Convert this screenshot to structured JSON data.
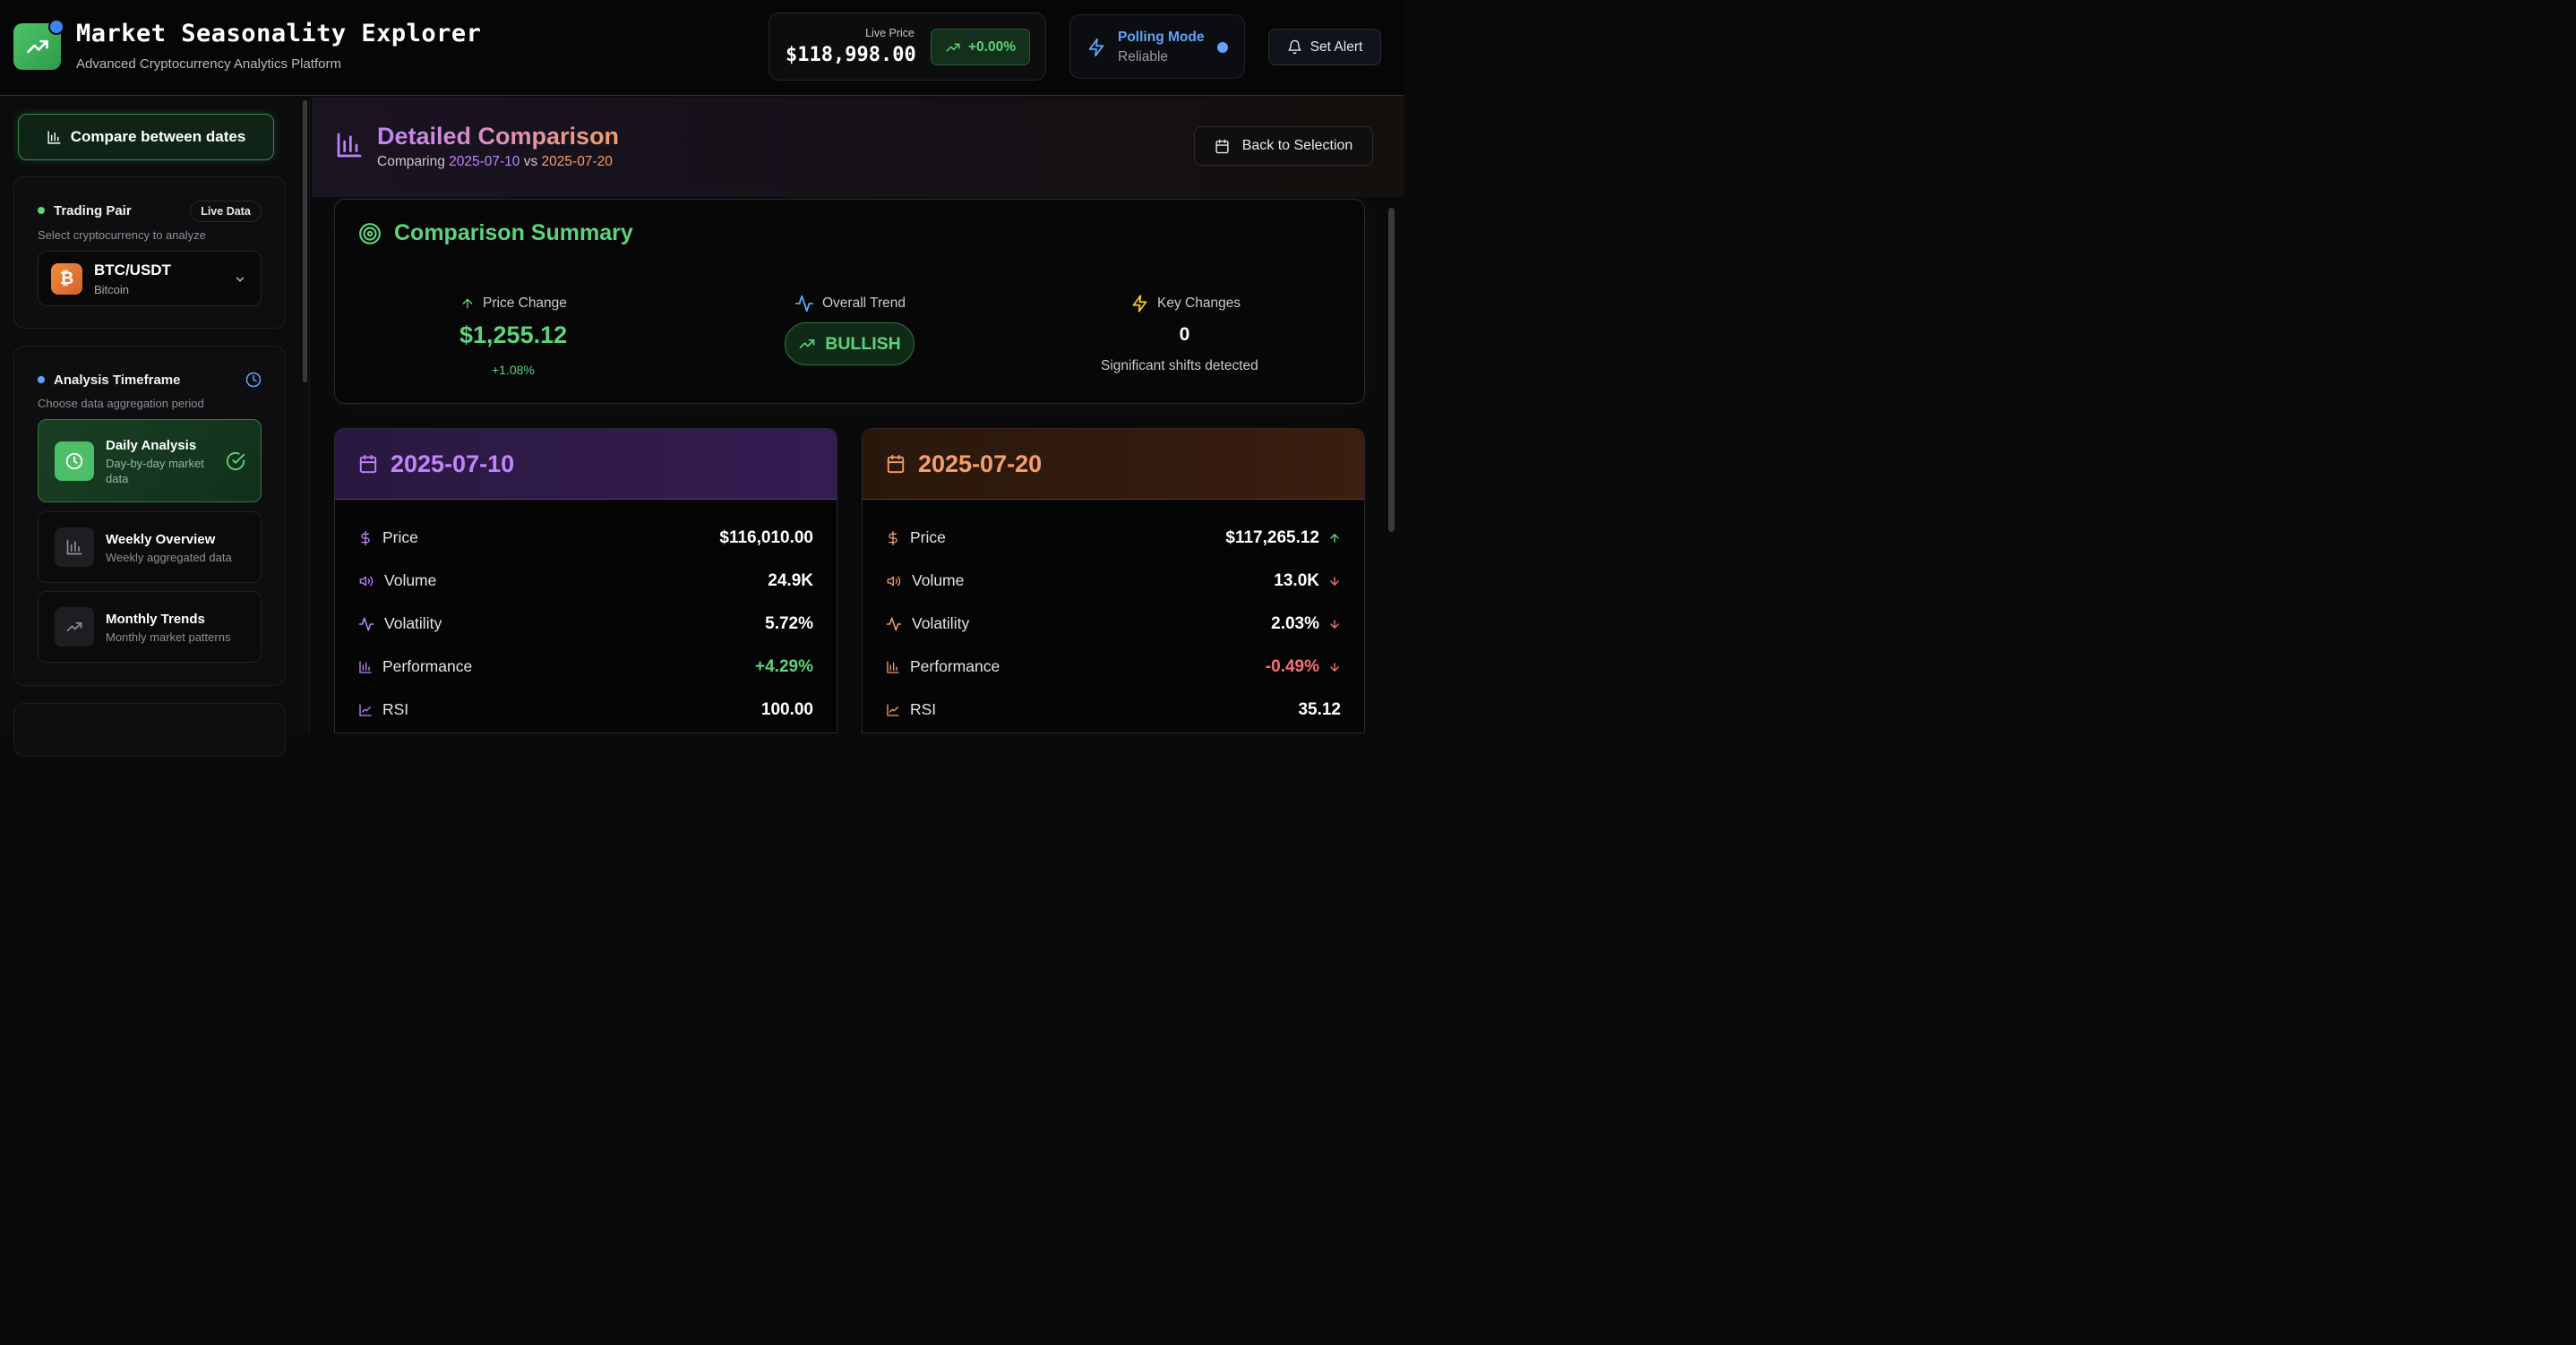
{
  "header": {
    "title": "Market Seasonality Explorer",
    "subtitle": "Advanced Cryptocurrency Analytics Platform",
    "live_price_label": "Live Price",
    "live_price": "$118,998.00",
    "price_change": "+0.00%",
    "polling_title": "Polling Mode",
    "polling_status": "Reliable",
    "set_alert": "Set Alert"
  },
  "sidebar": {
    "compare_button": "Compare between dates",
    "trading_pair": {
      "title": "Trading Pair",
      "badge": "Live Data",
      "description": "Select cryptocurrency to analyze",
      "symbol_glyph": "₿",
      "pair": "BTC/USDT",
      "name": "Bitcoin"
    },
    "timeframe": {
      "title": "Analysis Timeframe",
      "description": "Choose data aggregation period",
      "options": [
        {
          "title": "Daily Analysis",
          "desc_line1": "Day-by-day market",
          "desc_line2": "data",
          "selected": true
        },
        {
          "title": "Weekly Overview",
          "desc_line1": "Weekly aggregated data",
          "desc_line2": "",
          "selected": false
        },
        {
          "title": "Monthly Trends",
          "desc_line1": "Monthly market patterns",
          "desc_line2": "",
          "selected": false
        }
      ]
    }
  },
  "main": {
    "title": "Detailed Comparison",
    "compare_prefix": "Comparing",
    "date1": "2025-07-10",
    "vs": "vs",
    "date2": "2025-07-20",
    "back_button": "Back to Selection",
    "summary": {
      "title": "Comparison Summary",
      "price_change_label": "Price Change",
      "price_change_value": "$1,255.12",
      "price_change_pct": "+1.08%",
      "trend_label": "Overall Trend",
      "trend_value": "BULLISH",
      "key_label": "Key Changes",
      "key_value": "0",
      "key_desc": "Significant shifts detected"
    },
    "cards": [
      {
        "date": "2025-07-10",
        "rows": [
          {
            "label": "Price",
            "value": "$116,010.00"
          },
          {
            "label": "Volume",
            "value": "24.9K"
          },
          {
            "label": "Volatility",
            "value": "5.72%"
          },
          {
            "label": "Performance",
            "value": "+4.29%"
          },
          {
            "label": "RSI",
            "value": "100.00"
          }
        ]
      },
      {
        "date": "2025-07-20",
        "rows": [
          {
            "label": "Price",
            "value": "$117,265.12",
            "direction": "up"
          },
          {
            "label": "Volume",
            "value": "13.0K",
            "direction": "down"
          },
          {
            "label": "Volatility",
            "value": "2.03%",
            "direction": "down"
          },
          {
            "label": "Performance",
            "value": "-0.49%",
            "direction": "down"
          },
          {
            "label": "RSI",
            "value": "35.12"
          }
        ]
      }
    ]
  },
  "colors": {
    "accent_green": "#5fd37c",
    "accent_blue": "#60a5fa",
    "accent_purple": "#c084fc",
    "accent_orange": "#f59e6b",
    "negative_red": "#f87171"
  }
}
